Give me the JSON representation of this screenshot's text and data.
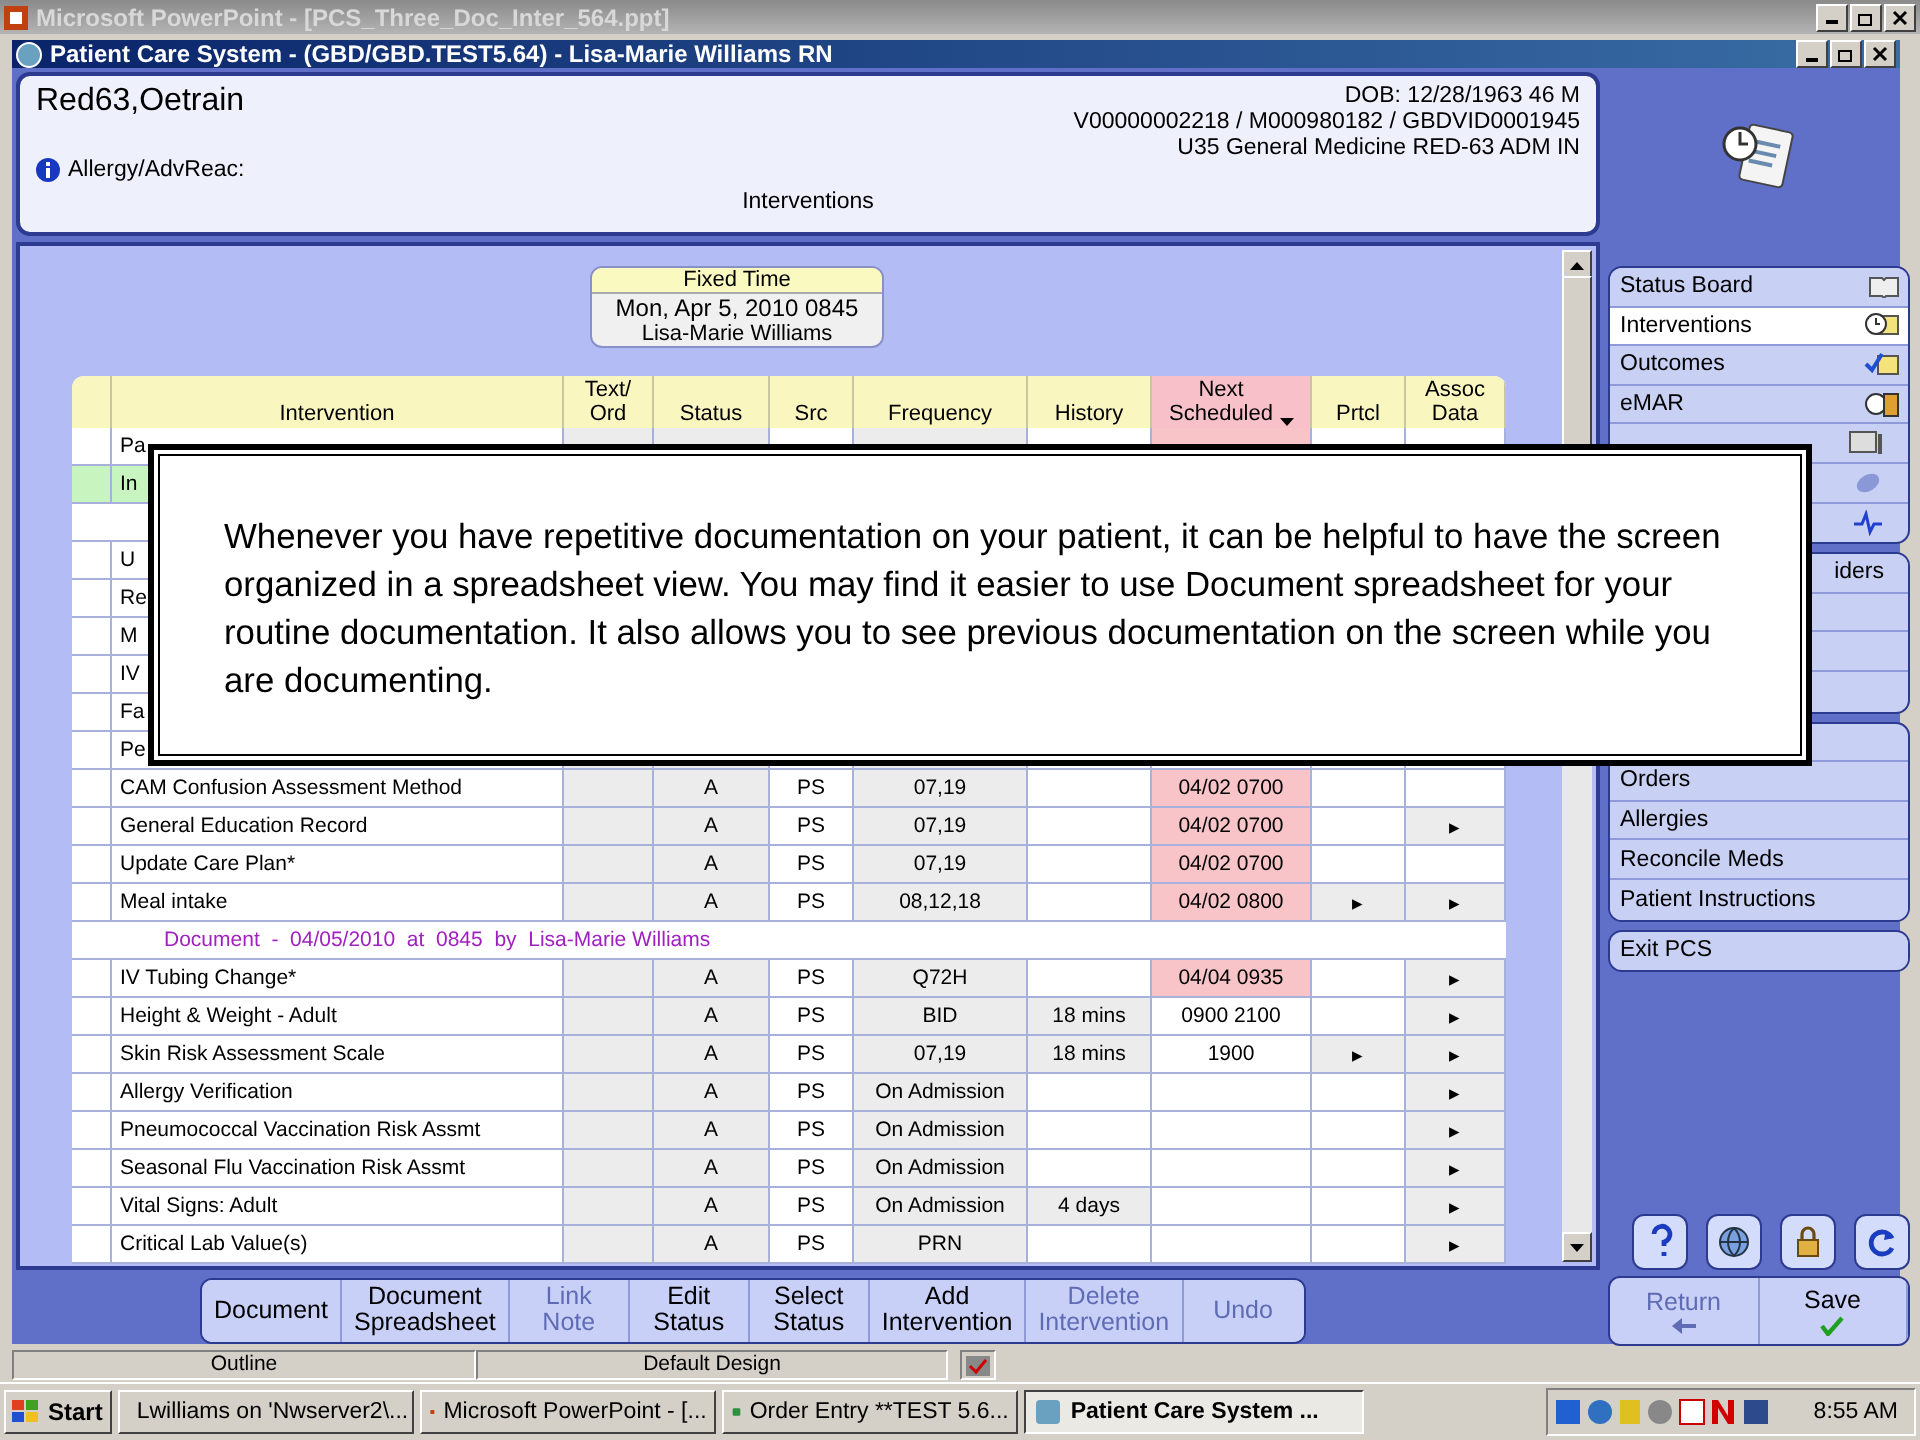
{
  "app_title": "Microsoft PowerPoint - [PCS_Three_Doc_Inter_564.ppt]",
  "window": {
    "title": "Patient Care System - (GBD/GBD.TEST5.64) - Lisa-Marie Williams RN"
  },
  "patient": {
    "name": "Red63,Oetrain",
    "dob": "DOB: 12/28/1963 46 M",
    "ids": "V00000002218 / M000980182 / GBDVID0001945",
    "location": "U35 General Medicine  RED-63  ADM IN",
    "allergy": "Allergy/AdvReac:",
    "section": "Interventions"
  },
  "fixed_time": {
    "title": "Fixed Time",
    "date": "Mon, Apr 5, 2010  0845",
    "user": "Lisa-Marie Williams"
  },
  "table": {
    "columns": [
      "Intervention",
      "Text/\nOrd",
      "Status",
      "Src",
      "Frequency",
      "History",
      "Next\nScheduled",
      "Prtcl",
      "Assoc\nData"
    ],
    "rows": [
      {
        "kind": "row",
        "name": "Pa",
        "overdue": true,
        "selected": false
      },
      {
        "kind": "row",
        "name": "In",
        "selected": true
      },
      {
        "kind": "hidden"
      },
      {
        "kind": "row",
        "name": "U",
        "selected": false
      },
      {
        "kind": "row",
        "name": "Re",
        "selected": false
      },
      {
        "kind": "row",
        "name": "M",
        "selected": false
      },
      {
        "kind": "row",
        "name": "IV",
        "selected": false
      },
      {
        "kind": "row",
        "name": "Fa",
        "selected": false
      },
      {
        "kind": "row",
        "name": "Pe",
        "selected": false
      },
      {
        "kind": "row",
        "name": "CAM Confusion Assessment Method",
        "status": "A",
        "src": "PS",
        "frequency": "07,19",
        "next": "04/02 0700",
        "overdue": true,
        "selected": false
      },
      {
        "kind": "row",
        "name": "General Education Record",
        "status": "A",
        "src": "PS",
        "frequency": "07,19",
        "next": "04/02 0700",
        "assoc": "▸",
        "overdue": true,
        "selected": false
      },
      {
        "kind": "row",
        "name": "Update Care Plan*",
        "status": "A",
        "src": "PS",
        "frequency": "07,19",
        "next": "04/02 0700",
        "overdue": true,
        "selected": false
      },
      {
        "kind": "row",
        "name": "Meal intake",
        "status": "A",
        "src": "PS",
        "frequency": "08,12,18",
        "next": "04/02 0800",
        "prtcl": "▸",
        "assoc": "▸",
        "overdue": true,
        "selected": false
      },
      {
        "kind": "document",
        "text": "Document  -  04/05/2010  at  0845  by  Lisa-Marie Williams"
      },
      {
        "kind": "row",
        "name": "IV Tubing Change*",
        "status": "A",
        "src": "PS",
        "frequency": "Q72H",
        "next": "04/04 0935",
        "assoc": "▸",
        "overdue": true,
        "selected": false
      },
      {
        "kind": "row",
        "name": "Height & Weight - Adult",
        "status": "A",
        "src": "PS",
        "frequency": "BID",
        "history": "18 mins",
        "next": "0900 2100",
        "assoc": "▸",
        "overdue": false,
        "selected": false
      },
      {
        "kind": "row",
        "name": "Skin Risk Assessment Scale",
        "status": "A",
        "src": "PS",
        "frequency": "07,19",
        "history": "18 mins",
        "next": "1900",
        "prtcl": "▸",
        "assoc": "▸",
        "overdue": false,
        "selected": false
      },
      {
        "kind": "row",
        "name": "Allergy Verification",
        "status": "A",
        "src": "PS",
        "frequency": "On Admission",
        "assoc": "▸",
        "overdue": false,
        "selected": false
      },
      {
        "kind": "row",
        "name": "Pneumococcal Vaccination Risk Assmt",
        "status": "A",
        "src": "PS",
        "frequency": "On Admission",
        "assoc": "▸",
        "overdue": false,
        "selected": false
      },
      {
        "kind": "row",
        "name": "Seasonal Flu Vaccination Risk Assmt",
        "status": "A",
        "src": "PS",
        "frequency": "On Admission",
        "assoc": "▸",
        "overdue": false,
        "selected": false
      },
      {
        "kind": "row",
        "name": "Vital Signs: Adult",
        "status": "A",
        "src": "PS",
        "frequency": "On Admission",
        "history": "4 days",
        "assoc": "▸",
        "overdue": false,
        "selected": false
      },
      {
        "kind": "row",
        "name": "Critical Lab Value(s)",
        "status": "A",
        "src": "PS",
        "frequency": "PRN",
        "assoc": "▸",
        "overdue": false,
        "selected": false
      }
    ]
  },
  "callout": "Whenever you have repetitive documentation on your patient, it can be helpful to have the screen organized in a spreadsheet view. You may find it easier to use Document spreadsheet for your routine documentation. It also allows you to see previous documentation on the screen while you are documenting.",
  "sidebar": {
    "groups": [
      [
        {
          "kind": "item",
          "label": "Status Board",
          "selected": false
        },
        {
          "kind": "item",
          "label": "Interventions",
          "selected": true
        },
        {
          "kind": "item",
          "label": "Outcomes",
          "selected": false
        },
        {
          "kind": "item",
          "label": "eMAR",
          "selected": false
        },
        {
          "kind": "hidden"
        },
        {
          "kind": "hidden"
        },
        {
          "kind": "hidden"
        }
      ],
      [
        {
          "kind": "partial",
          "label": "iders"
        },
        {
          "kind": "hidden"
        },
        {
          "kind": "hidden"
        },
        {
          "kind": "hidden"
        }
      ],
      [
        {
          "kind": "hidden"
        },
        {
          "kind": "item",
          "label": "Orders",
          "selected": false
        },
        {
          "kind": "item",
          "label": "Allergies",
          "selected": false
        },
        {
          "kind": "item",
          "label": "Reconcile Meds",
          "selected": false
        },
        {
          "kind": "item",
          "label": "Patient Instructions",
          "selected": false
        }
      ],
      [
        {
          "kind": "item",
          "label": "Exit PCS",
          "selected": false
        }
      ]
    ]
  },
  "toolbar": [
    {
      "label": "Document",
      "disabled": false
    },
    {
      "label": "Document\nSpreadsheet",
      "disabled": false
    },
    {
      "label": "Link\nNote",
      "disabled": true
    },
    {
      "label": "Edit\nStatus",
      "disabled": false
    },
    {
      "label": "Select\nStatus",
      "disabled": false
    },
    {
      "label": "Add\nIntervention",
      "disabled": false
    },
    {
      "label": "Delete\nIntervention",
      "disabled": true
    },
    {
      "label": "Undo",
      "disabled": true
    }
  ],
  "nav_buttons": [
    {
      "label": "Return",
      "disabled": true
    },
    {
      "label": "Save",
      "disabled": false
    }
  ],
  "app_status": [
    "Outline",
    "Default Design"
  ],
  "taskbar": {
    "start": "Start",
    "tasks": [
      {
        "label": "Lwilliams on 'Nwserver2\\...",
        "selected": false
      },
      {
        "label": "Microsoft PowerPoint - [...",
        "selected": false
      },
      {
        "label": "Order Entry **TEST 5.6...",
        "selected": false
      },
      {
        "label": "Patient Care System ...",
        "selected": true
      }
    ],
    "clock": "8:55 AM"
  }
}
